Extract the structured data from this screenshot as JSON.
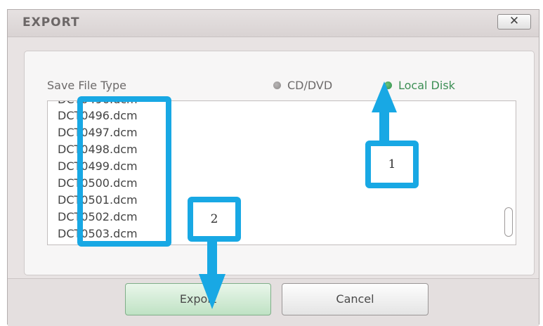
{
  "dialog": {
    "title": "EXPORT",
    "close_label": "✕"
  },
  "save_file_type": {
    "label": "Save File Type",
    "options": [
      {
        "label": "CD/DVD",
        "selected": false,
        "color": "#9a9797"
      },
      {
        "label": "Local Disk",
        "selected": true,
        "color": "#3d8f55"
      }
    ]
  },
  "file_list": {
    "items": [
      "DCT0496.dcm",
      "DCT0497.dcm",
      "DCT0498.dcm",
      "DCT0499.dcm",
      "DCT0500.dcm",
      "DCT0501.dcm",
      "DCT0502.dcm",
      "DCT0503.dcm"
    ]
  },
  "buttons": {
    "export_label": "Export",
    "cancel_label": "Cancel"
  },
  "annotations": {
    "step1": "1",
    "step2": "2",
    "highlight_color": "#18a8e4"
  }
}
